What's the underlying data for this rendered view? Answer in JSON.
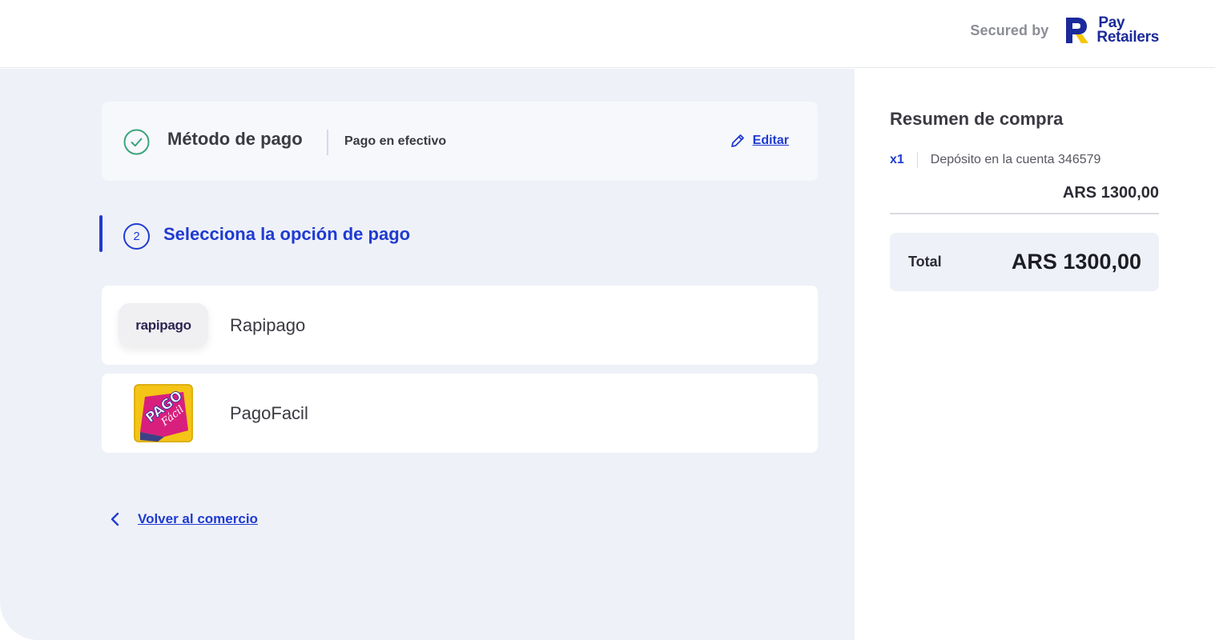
{
  "header": {
    "secured_by": "Secured by",
    "brand_line1": "Pay",
    "brand_line2": "Retailers"
  },
  "payment_method": {
    "title": "Método de pago",
    "value": "Pago en efectivo",
    "edit_label": "Editar",
    "status_color": "#3aa57a"
  },
  "step": {
    "number": "2",
    "title": "Selecciona la opción de pago"
  },
  "options": [
    {
      "label": "Rapipago",
      "logo_text": "rapipago",
      "icon": "rapipago-logo"
    },
    {
      "label": "PagoFacil",
      "logo_text": [
        "PAGO",
        "Fácil"
      ],
      "icon": "pagofacil-logo"
    }
  ],
  "back_link": "Volver al comercio",
  "summary": {
    "title": "Resumen de compra",
    "quantity": "x1",
    "description": "Depósito en la cuenta 346579",
    "price": "ARS 1300,00",
    "total_label": "Total",
    "total_value": "ARS 1300,00"
  },
  "colors": {
    "accent": "#1f3bd1",
    "background_main": "#eff1f8",
    "brand_blue": "#1b2a9b",
    "brand_yellow": "#f7c600"
  }
}
